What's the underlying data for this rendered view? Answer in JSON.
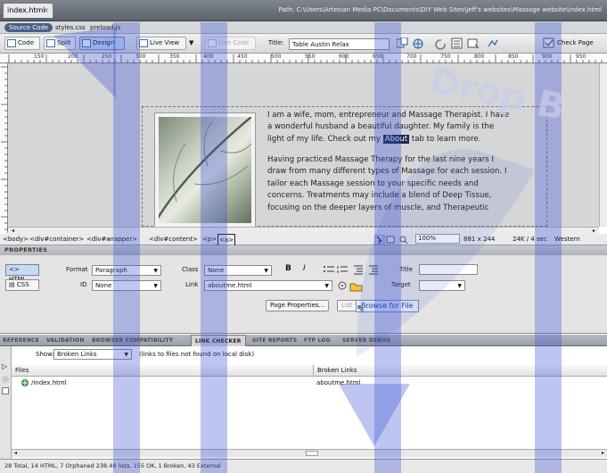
{
  "doc": {
    "tab_label": "index.html",
    "tab_close": "×",
    "path": "Path: C:\\Users\\Artesian Media PC\\Documents\\DIY Web Sites\\Jeff's websites\\Massage website\\index.html"
  },
  "related_files": {
    "source_code": "Source Code",
    "files": [
      "styles.css",
      "preload.js"
    ]
  },
  "toolbar": {
    "code": "Code",
    "split": "Split",
    "design": "Design",
    "live_view": "Live View",
    "live_code": "Live Code",
    "title_label": "Title:",
    "title_value": "Table Austin Relax",
    "check_page": "Check Page"
  },
  "ruler": {
    "ticks": [
      "150",
      "200",
      "250",
      "300",
      "350",
      "400",
      "450",
      "500",
      "550",
      "600",
      "650",
      "700",
      "750",
      "800",
      "850",
      "900",
      "950"
    ]
  },
  "content": {
    "para1_a": "I am a wife, mom, entrepreneur and Massage Therapist. I have",
    "para1_b": "a wonderful husband a beautiful daughter. My family is the",
    "para1_c_pre": "light of my life. Check out my ",
    "para1_c_link": "About",
    "para1_c_post": " tab to learn more.",
    "para2_a": "Having practiced Massage Therapy for the last nine years I",
    "para2_b": "draw from many different types of Massage for each session. I",
    "para2_c": "tailor each Massage session to your specific needs and",
    "para2_d": "concerns. Treatments may include a blend of Deep Tissue,",
    "para2_e": "focusing on the deeper layers of muscle, and Therapeutic"
  },
  "tag_selector": {
    "tags": [
      "<body>",
      "<div#container>",
      "<div#wrapper>",
      "<div#content>",
      "<p>",
      "<a>"
    ],
    "zoom": "100%",
    "dims": "881 x 244",
    "size": "24K / 4 sec",
    "encoding": "Western European"
  },
  "properties": {
    "header": "PROPERTIES",
    "html_btn": "HTML",
    "css_btn": "CSS",
    "format_label": "Format",
    "format_value": "Paragraph",
    "id_label": "ID",
    "id_value": "None",
    "class_label": "Class",
    "class_value": "None",
    "link_label": "Link",
    "link_value": "aboutme.html",
    "bold": "B",
    "italic": "I",
    "title_label": "Title",
    "target_label": "Target",
    "page_properties": "Page Properties...",
    "list_item": "List Item...",
    "tooltip": "Browse for File"
  },
  "results": {
    "tabs": [
      "REFERENCE",
      "VALIDATION",
      "BROWSER COMPATIBILITY",
      "LINK CHECKER",
      "SITE REPORTS",
      "FTP LOG",
      "SERVER DEBUG"
    ],
    "active_tab": "LINK CHECKER",
    "show_label": "Show:",
    "show_value": "Broken Links",
    "show_hint": "(links to files not found on local disk)",
    "col_files": "Files",
    "col_broken": "Broken Links",
    "row_file": "/index.html",
    "row_link": "aboutme.html",
    "status": "28 Total, 14 HTML, 7 Orphaned 238.48 lists, 155 OK, 1 Broken, 43 External"
  },
  "watermark": "Drop B",
  "colors": {
    "accent_blue": "#4a5f86",
    "selection": "#1d2b48",
    "watermark": "#3b4fd6"
  }
}
